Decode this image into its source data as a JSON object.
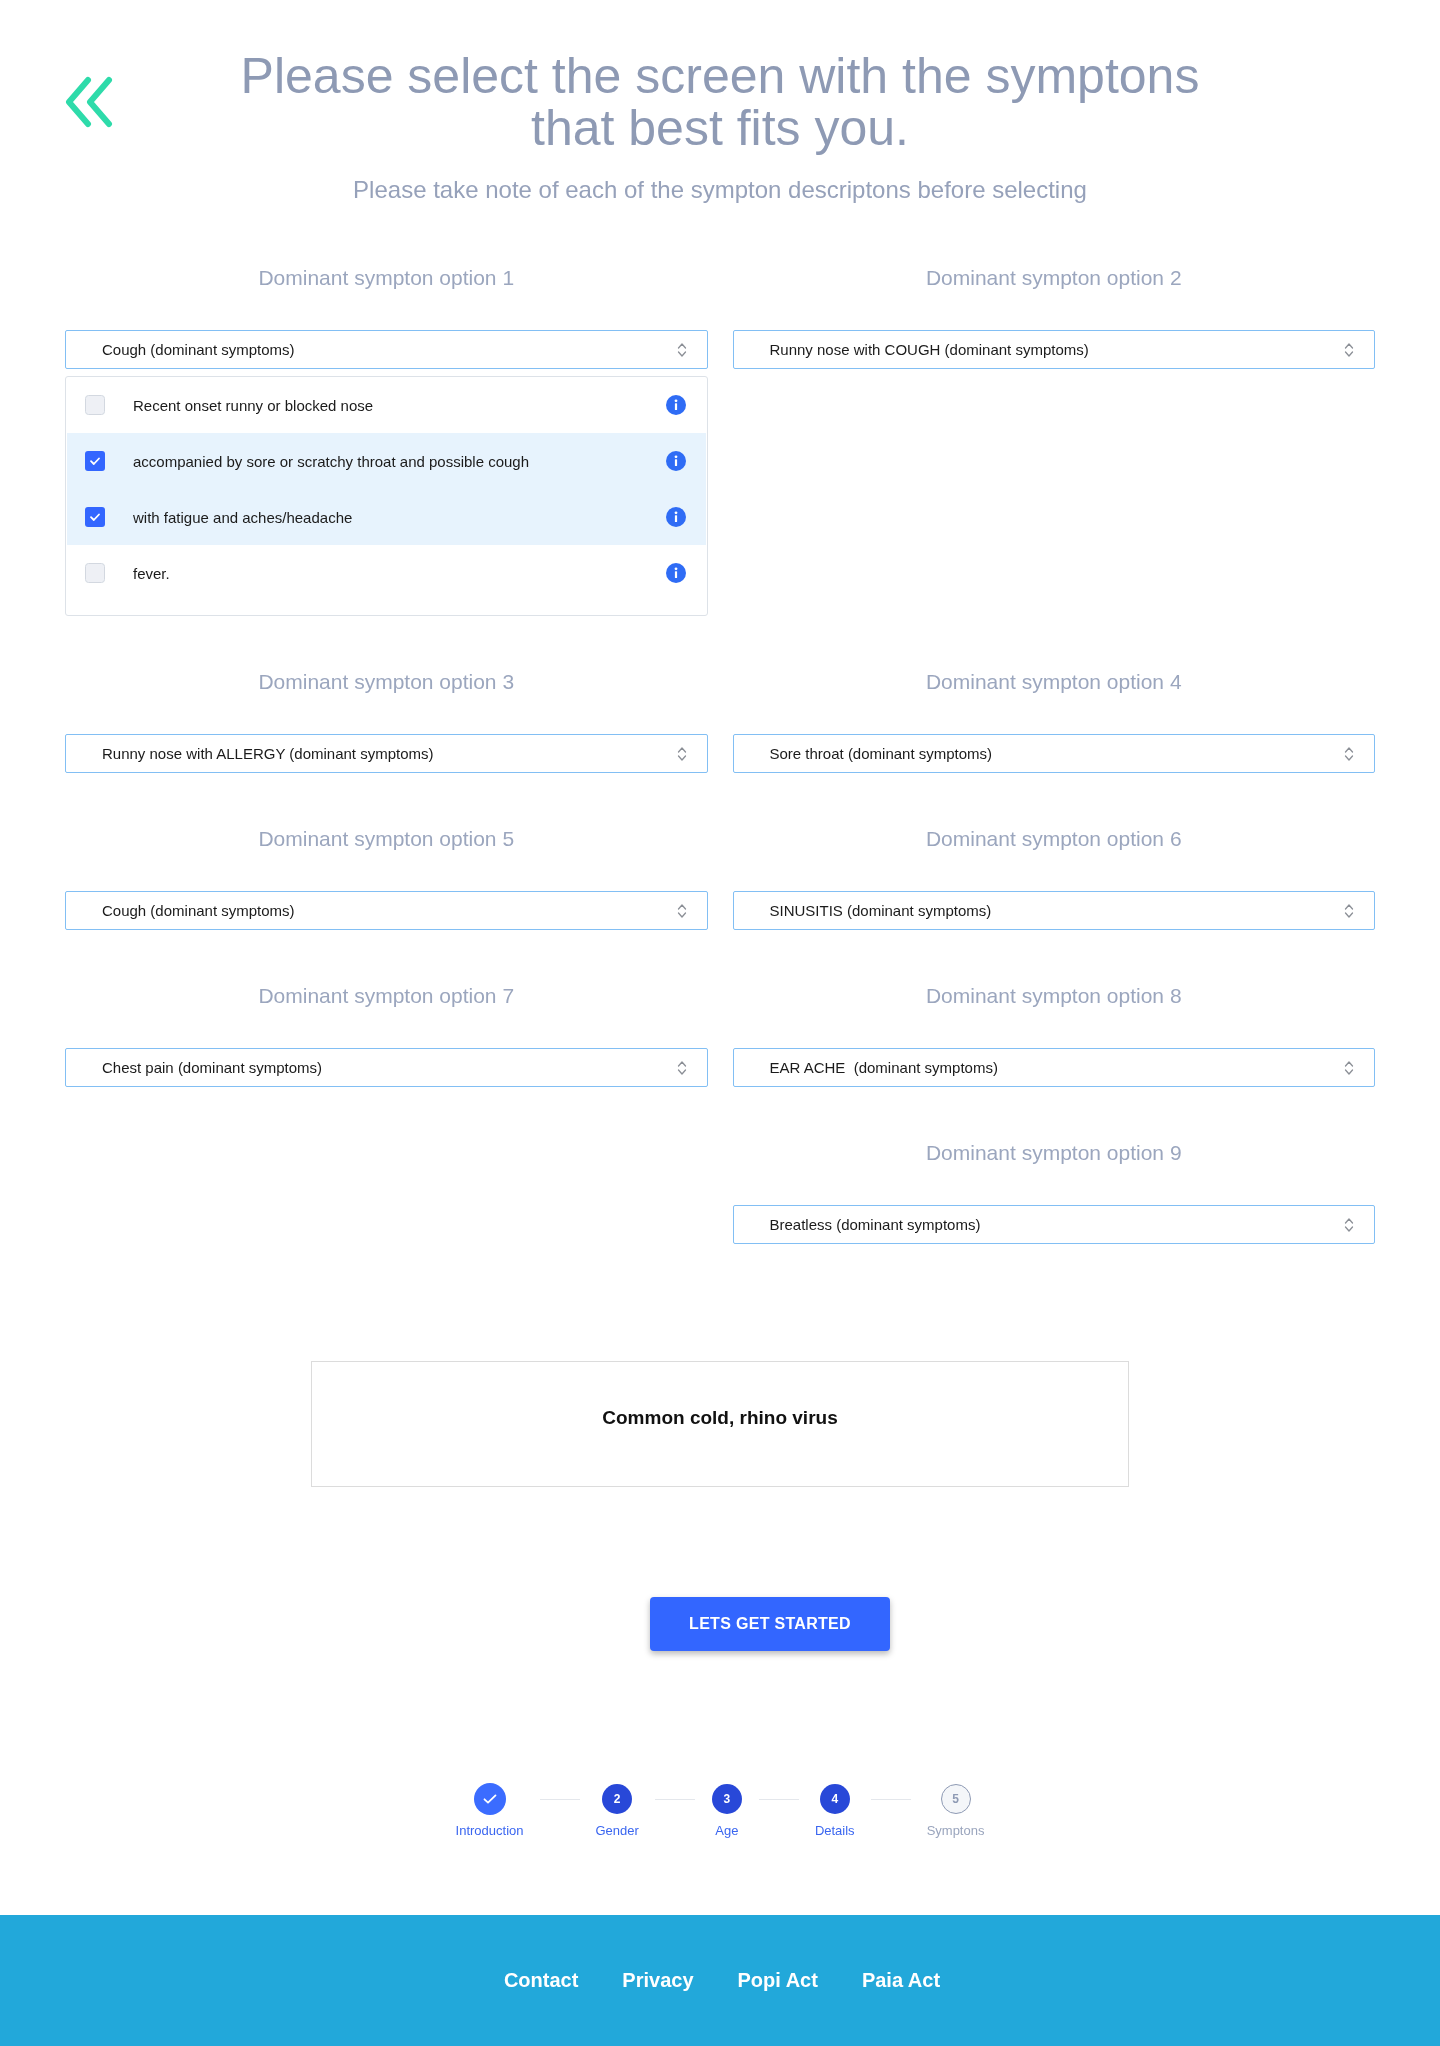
{
  "header": {
    "title": "Please select the screen with the symptons that best fits you.",
    "subtitle": "Please take note of each of the sympton descriptons before selecting"
  },
  "options": [
    {
      "label": "Dominant sympton option 1",
      "value": "Cough (dominant symptoms)",
      "items": [
        {
          "text": "Recent onset runny or blocked nose",
          "checked": false
        },
        {
          "text": "accompanied by sore or scratchy throat and possible cough",
          "checked": true
        },
        {
          "text": "with fatigue and aches/headache",
          "checked": true
        },
        {
          "text": "fever.",
          "checked": false
        }
      ]
    },
    {
      "label": "Dominant sympton option 2",
      "value": "Runny nose with COUGH (dominant symptoms)"
    },
    {
      "label": "Dominant sympton option 3",
      "value": "Runny nose with ALLERGY (dominant symptoms)"
    },
    {
      "label": "Dominant sympton option 4",
      "value": "Sore throat (dominant symptoms)"
    },
    {
      "label": "Dominant sympton option 5",
      "value": "Cough (dominant symptoms)"
    },
    {
      "label": "Dominant sympton option 6",
      "value": "SINUSITIS (dominant symptoms)"
    },
    {
      "label": "Dominant sympton option 7",
      "value": "Chest pain (dominant symptoms)"
    },
    {
      "label": "Dominant sympton option 8",
      "value": "EAR ACHE  (dominant symptoms)"
    },
    {
      "label": "Dominant sympton option 9",
      "value": "Breatless (dominant symptoms)"
    }
  ],
  "result": "Common cold, rhino virus",
  "button": "LETS GET STARTED",
  "steps": [
    {
      "label": "Introduction",
      "completed": true,
      "reached": true
    },
    {
      "number": "2",
      "label": "Gender",
      "completed": false,
      "reached": true
    },
    {
      "number": "3",
      "label": "Age",
      "completed": false,
      "reached": true
    },
    {
      "number": "4",
      "label": "Details",
      "completed": false,
      "reached": true
    },
    {
      "number": "5",
      "label": "Symptons",
      "completed": false,
      "reached": false
    }
  ],
  "footer": {
    "links": [
      "Contact",
      "Privacy",
      "Popi Act",
      "Paia Act"
    ]
  }
}
